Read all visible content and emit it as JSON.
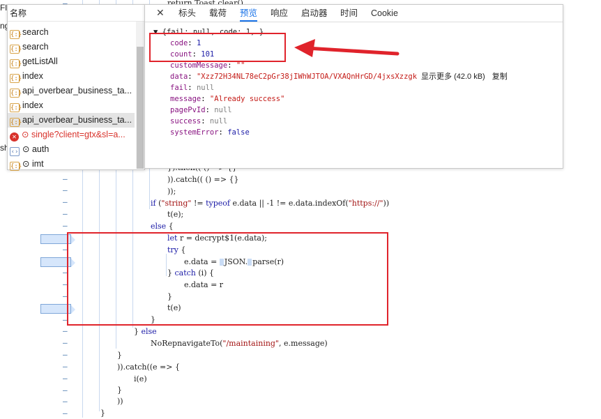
{
  "left_fragments": [
    "Flask",
    "ng",
    "sh"
  ],
  "code_lines": {
    "toast": "return Toast.clear(),",
    "then": "}).then(( () => {}",
    "catch1": ")).catch(( () => {}",
    "close1": "));",
    "if_kw": "if",
    "if_rest_a": " (",
    "if_str": "\"string\"",
    "if_rest_b": " != ",
    "if_typeof": "typeof",
    "if_rest_c": " e.data || -1 != e.data.indexOf(",
    "if_url": "\"https://\"",
    "if_rest_d": "))",
    "te1": "t(e);",
    "else_kw": "else",
    "else_rest": " {",
    "let_kw": "let",
    "let_rest": " r = decrypt$1(e.data);",
    "try_kw": "try",
    "try_rest": " {",
    "edata_a": "e.data = ",
    "edata_b": "JSON.",
    "edata_c": "parse(r)",
    "catch_a": "} ",
    "catch_kw": "catch",
    "catch_rest": " (i) {",
    "edata_r": "e.data = r",
    "close2": "}",
    "te2": "t(e)",
    "close3": "}",
    "else2_a": "} ",
    "else2_kw": "else",
    "norep_a": "NoRepnavigateTo(",
    "norep_str": "\"/maintaining\"",
    "norep_b": ", e.message)",
    "close4": "}",
    "catch3": ")).catch((e => {",
    "ie": "i(e)",
    "close5": "}",
    "close6": "))",
    "close7": "}"
  },
  "request_list": {
    "header": "名称",
    "items": [
      {
        "name": "search",
        "icon": "{:}",
        "kind": "xhr"
      },
      {
        "name": "search",
        "icon": "{:}",
        "kind": "xhr"
      },
      {
        "name": "getListAll",
        "icon": "{:}",
        "kind": "xhr"
      },
      {
        "name": "index",
        "icon": "{:}",
        "kind": "xhr"
      },
      {
        "name": "api_overbear_business_ta...",
        "icon": "{:}",
        "kind": "xhr"
      },
      {
        "name": "index",
        "icon": "{:}",
        "kind": "xhr"
      },
      {
        "name": "api_overbear_business_ta...",
        "icon": "{:}",
        "kind": "xhr",
        "selected": true
      },
      {
        "name": "⊙ single?client=gtx&sl=a...",
        "icon": "✕",
        "kind": "error"
      },
      {
        "name": "⊙ auth",
        "icon": "‹›",
        "kind": "doc"
      },
      {
        "name": "⊙ imt",
        "icon": "{:}",
        "kind": "xhr"
      }
    ]
  },
  "preview": {
    "tabs": [
      "标头",
      "载荷",
      "预览",
      "响应",
      "启动器",
      "时间",
      "Cookie"
    ],
    "active_tab": "预览",
    "summary": "▼ {fail: null, code: 1,…}",
    "fields": [
      {
        "key": "code",
        "value": "1",
        "type": "num"
      },
      {
        "key": "count",
        "value": "101",
        "type": "num"
      },
      {
        "key": "customMessage",
        "value": "\"\"",
        "type": "str"
      },
      {
        "key": "data",
        "value": "\"Xzz72H34NL78eC2pGr38jIWhWJTOA/VXAQnHrGD/4jxsXzzgk",
        "type": "str"
      },
      {
        "key": "fail",
        "value": "null",
        "type": "null"
      },
      {
        "key": "message",
        "value": "\"Already success\"",
        "type": "str"
      },
      {
        "key": "pagePvId",
        "value": "null",
        "type": "null"
      },
      {
        "key": "success",
        "value": "null",
        "type": "null"
      },
      {
        "key": "systemError",
        "value": "false",
        "type": "bool"
      }
    ],
    "show_more": "显示更多 (42.0 kB)",
    "copy": "复制"
  },
  "colors": {
    "accent": "#1a73e8",
    "annotation_red": "#e0232b",
    "error_red": "#d8322b"
  }
}
